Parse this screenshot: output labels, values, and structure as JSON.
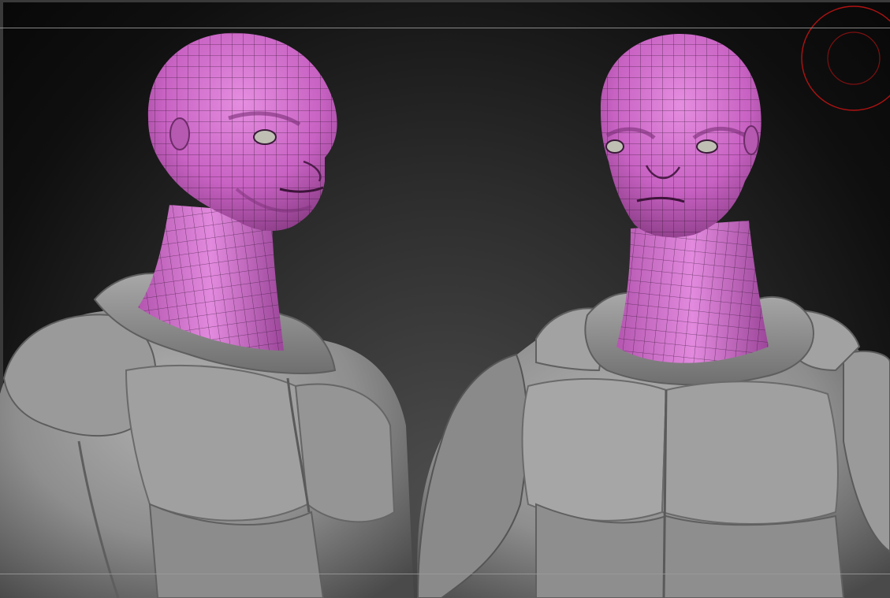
{
  "app": "ZBrush viewport",
  "viewport": {
    "background_colors": [
      "#4e4e4e",
      "#2c2c2c",
      "#0f0f0f"
    ],
    "guide_line_color": "#9a9a9a"
  },
  "models": [
    {
      "name": "alien-bust-three-quarter",
      "head_color": "#d36fce",
      "body_color": "#9c9c9c",
      "eye_color": "#bfbfb4"
    },
    {
      "name": "alien-bust-front",
      "head_color": "#d36fce",
      "body_color": "#9c9c9c",
      "eye_color": "#bfbfb4"
    }
  ],
  "brush_cursor": {
    "icon": "brush-radius-cursor-icon",
    "color": "#b01212"
  }
}
